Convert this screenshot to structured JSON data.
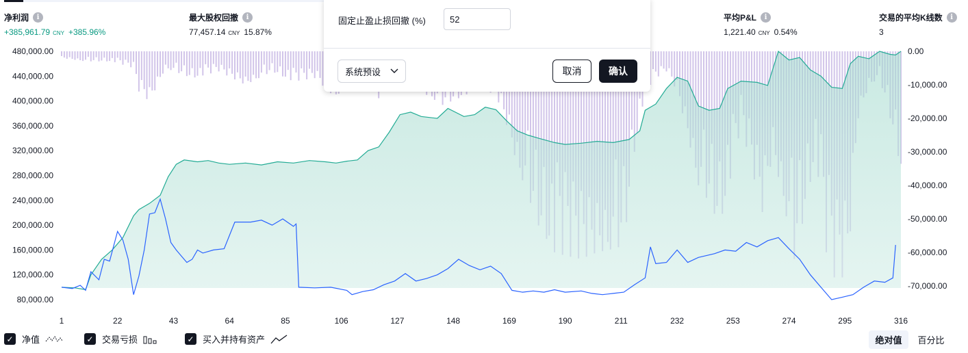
{
  "metrics": [
    {
      "label": "净利润",
      "value": "+385,961.79",
      "unit": "CNY",
      "pct": "+385.96%",
      "positive": true
    },
    {
      "label": "最大股权回撤",
      "value": "77,457.14",
      "unit": "CNY",
      "pct": "15.87%",
      "positive": false
    },
    {
      "label": "平均P&L",
      "value": "1,221.40",
      "unit": "CNY",
      "pct": "0.54%",
      "positive": false
    },
    {
      "label": "交易的平均K线数",
      "value": "3",
      "unit": "",
      "pct": "",
      "positive": false
    }
  ],
  "popup": {
    "field_label": "固定止盈止损回撤 (%)",
    "field_value": "52",
    "preset_label": "系统预设",
    "cancel_label": "取消",
    "confirm_label": "确认"
  },
  "legend": [
    {
      "label": "净值",
      "checked": true,
      "icon": "wave-icon"
    },
    {
      "label": "交易亏损",
      "checked": true,
      "icon": "bars-icon"
    },
    {
      "label": "买入并持有资产",
      "checked": true,
      "icon": "line-icon"
    }
  ],
  "toggles": [
    {
      "label": "绝对值",
      "active": true
    },
    {
      "label": "百分比",
      "active": false
    }
  ],
  "chart_data": {
    "type": "area",
    "x_ticks": [
      1,
      22,
      43,
      64,
      85,
      106,
      127,
      148,
      169,
      190,
      211,
      232,
      253,
      274,
      295,
      316
    ],
    "xlim": [
      1,
      320
    ],
    "left_axis": {
      "ticks": [
        "480,000.00",
        "440,000.00",
        "400,000.00",
        "360,000.00",
        "320,000.00",
        "280,000.00",
        "240,000.00",
        "200,000.00",
        "160,000.00",
        "120,000.00",
        "80,000.00"
      ],
      "ylim": [
        80000,
        480000
      ]
    },
    "right_axis": {
      "ticks": [
        "0.00",
        "-10,000.00",
        "-20,000.00",
        "-30,000.00",
        "-40,000.00",
        "-50,000.00",
        "-60,000.00",
        "-70,000.00"
      ],
      "ylim": [
        -72500,
        0
      ]
    },
    "series": [
      {
        "name": "净值",
        "color": "#22ab94",
        "fill": "#d4eee8",
        "points": [
          [
            1,
            100000
          ],
          [
            6,
            99000
          ],
          [
            10,
            96000
          ],
          [
            12,
            120000
          ],
          [
            16,
            145000
          ],
          [
            20,
            160000
          ],
          [
            24,
            180000
          ],
          [
            28,
            215000
          ],
          [
            30,
            225000
          ],
          [
            34,
            235000
          ],
          [
            38,
            248000
          ],
          [
            41,
            278000
          ],
          [
            44,
            298000
          ],
          [
            47,
            305000
          ],
          [
            52,
            302000
          ],
          [
            56,
            304000
          ],
          [
            60,
            300000
          ],
          [
            64,
            298000
          ],
          [
            70,
            300000
          ],
          [
            76,
            297000
          ],
          [
            82,
            302000
          ],
          [
            88,
            300000
          ],
          [
            94,
            304000
          ],
          [
            100,
            302000
          ],
          [
            104,
            300000
          ],
          [
            108,
            303000
          ],
          [
            112,
            305000
          ],
          [
            116,
            320000
          ],
          [
            120,
            326000
          ],
          [
            124,
            350000
          ],
          [
            128,
            378000
          ],
          [
            132,
            382000
          ],
          [
            136,
            375000
          ],
          [
            142,
            372000
          ],
          [
            146,
            388000
          ],
          [
            152,
            375000
          ],
          [
            156,
            378000
          ],
          [
            160,
            390000
          ],
          [
            164,
            386000
          ],
          [
            168,
            368000
          ],
          [
            172,
            352000
          ],
          [
            176,
            345000
          ],
          [
            180,
            340000
          ],
          [
            186,
            333000
          ],
          [
            190,
            330000
          ],
          [
            196,
            332000
          ],
          [
            202,
            335000
          ],
          [
            208,
            333000
          ],
          [
            214,
            338000
          ],
          [
            218,
            352000
          ],
          [
            220,
            385000
          ],
          [
            224,
            395000
          ],
          [
            228,
            420000
          ],
          [
            232,
            438000
          ],
          [
            236,
            432000
          ],
          [
            240,
            392000
          ],
          [
            244,
            385000
          ],
          [
            248,
            388000
          ],
          [
            251,
            420000
          ],
          [
            256,
            432000
          ],
          [
            262,
            430000
          ],
          [
            266,
            425000
          ],
          [
            270,
            480000
          ],
          [
            274,
            466000
          ],
          [
            278,
            470000
          ],
          [
            282,
            450000
          ],
          [
            286,
            440000
          ],
          [
            290,
            422000
          ],
          [
            294,
            420000
          ],
          [
            297,
            460000
          ],
          [
            300,
            472000
          ],
          [
            304,
            468000
          ],
          [
            308,
            480000
          ],
          [
            312,
            475000
          ],
          [
            314,
            474000
          ],
          [
            316,
            480000
          ]
        ]
      },
      {
        "name": "买入并持有资产",
        "color": "#2962ff",
        "points": [
          [
            1,
            100000
          ],
          [
            5,
            98000
          ],
          [
            8,
            103000
          ],
          [
            10,
            95000
          ],
          [
            12,
            125000
          ],
          [
            15,
            112000
          ],
          [
            17,
            145000
          ],
          [
            19,
            142000
          ],
          [
            22,
            190000
          ],
          [
            24,
            176000
          ],
          [
            26,
            145000
          ],
          [
            28,
            88000
          ],
          [
            30,
            118000
          ],
          [
            32,
            160000
          ],
          [
            34,
            218000
          ],
          [
            36,
            220000
          ],
          [
            38,
            242000
          ],
          [
            40,
            210000
          ],
          [
            42,
            172000
          ],
          [
            44,
            160000
          ],
          [
            46,
            150000
          ],
          [
            48,
            140000
          ],
          [
            50,
            145000
          ],
          [
            52,
            160000
          ],
          [
            54,
            155000
          ],
          [
            58,
            160000
          ],
          [
            62,
            162000
          ],
          [
            66,
            205000
          ],
          [
            72,
            205000
          ],
          [
            76,
            208000
          ],
          [
            80,
            200000
          ],
          [
            84,
            210000
          ],
          [
            88,
            198000
          ],
          [
            89,
            202000
          ],
          [
            90,
            100000
          ],
          [
            96,
            99000
          ],
          [
            102,
            100000
          ],
          [
            108,
            95000
          ],
          [
            110,
            88000
          ],
          [
            114,
            93000
          ],
          [
            118,
            96000
          ],
          [
            122,
            104000
          ],
          [
            126,
            110000
          ],
          [
            130,
            122000
          ],
          [
            134,
            110000
          ],
          [
            138,
            114000
          ],
          [
            142,
            120000
          ],
          [
            146,
            130000
          ],
          [
            150,
            145000
          ],
          [
            154,
            135000
          ],
          [
            158,
            128000
          ],
          [
            162,
            134000
          ],
          [
            166,
            122000
          ],
          [
            170,
            95000
          ],
          [
            174,
            92000
          ],
          [
            178,
            94000
          ],
          [
            182,
            92000
          ],
          [
            186,
            96000
          ],
          [
            190,
            92000
          ],
          [
            196,
            94000
          ],
          [
            200,
            90000
          ],
          [
            204,
            88000
          ],
          [
            208,
            90000
          ],
          [
            212,
            92000
          ],
          [
            216,
            104000
          ],
          [
            220,
            115000
          ],
          [
            222,
            165000
          ],
          [
            224,
            138000
          ],
          [
            228,
            140000
          ],
          [
            232,
            160000
          ],
          [
            236,
            140000
          ],
          [
            240,
            148000
          ],
          [
            246,
            154000
          ],
          [
            250,
            160000
          ],
          [
            254,
            158000
          ],
          [
            258,
            172000
          ],
          [
            262,
            165000
          ],
          [
            266,
            175000
          ],
          [
            270,
            180000
          ],
          [
            274,
            162000
          ],
          [
            278,
            145000
          ],
          [
            282,
            120000
          ],
          [
            286,
            100000
          ],
          [
            290,
            80000
          ],
          [
            294,
            84000
          ],
          [
            298,
            88000
          ],
          [
            302,
            100000
          ],
          [
            306,
            110000
          ],
          [
            310,
            108000
          ],
          [
            313,
            115000
          ],
          [
            314,
            168000
          ]
        ]
      },
      {
        "name": "交易亏损",
        "color": "#b39ddb",
        "type": "bar",
        "values_note": "per-bar drawdown in CNY (negative)",
        "profile": [
          [
            1,
            -2000
          ],
          [
            10,
            -3000
          ],
          [
            20,
            -3000
          ],
          [
            28,
            -5000
          ],
          [
            30,
            -12000
          ],
          [
            34,
            -15000
          ],
          [
            40,
            -5000
          ],
          [
            50,
            -8000
          ],
          [
            60,
            -6000
          ],
          [
            70,
            -10000
          ],
          [
            80,
            -6000
          ],
          [
            88,
            -9000
          ],
          [
            96,
            -8000
          ],
          [
            104,
            -14000
          ],
          [
            110,
            -6000
          ],
          [
            120,
            -14000
          ],
          [
            128,
            -8000
          ],
          [
            136,
            -12000
          ],
          [
            144,
            -16000
          ],
          [
            150,
            -14000
          ],
          [
            158,
            -11000
          ],
          [
            164,
            -13000
          ],
          [
            168,
            -22000
          ],
          [
            172,
            -34000
          ],
          [
            176,
            -43000
          ],
          [
            180,
            -52000
          ],
          [
            186,
            -60000
          ],
          [
            190,
            -61000
          ],
          [
            196,
            -62000
          ],
          [
            202,
            -60000
          ],
          [
            208,
            -59000
          ],
          [
            212,
            -58000
          ],
          [
            216,
            -30000
          ],
          [
            220,
            -12000
          ],
          [
            224,
            -8000
          ],
          [
            228,
            -6000
          ],
          [
            232,
            -12000
          ],
          [
            236,
            -25000
          ],
          [
            240,
            -40000
          ],
          [
            244,
            -45000
          ],
          [
            248,
            -52000
          ],
          [
            252,
            -38000
          ],
          [
            256,
            -22000
          ],
          [
            260,
            -35000
          ],
          [
            264,
            -48000
          ],
          [
            268,
            -30000
          ],
          [
            272,
            -45000
          ],
          [
            276,
            -62000
          ],
          [
            280,
            -48000
          ],
          [
            284,
            -30000
          ],
          [
            288,
            -60000
          ],
          [
            292,
            -70000
          ],
          [
            296,
            -65000
          ],
          [
            300,
            -20000
          ],
          [
            304,
            -10000
          ],
          [
            308,
            -8000
          ],
          [
            312,
            -20000
          ],
          [
            316,
            -35000
          ]
        ]
      }
    ]
  }
}
